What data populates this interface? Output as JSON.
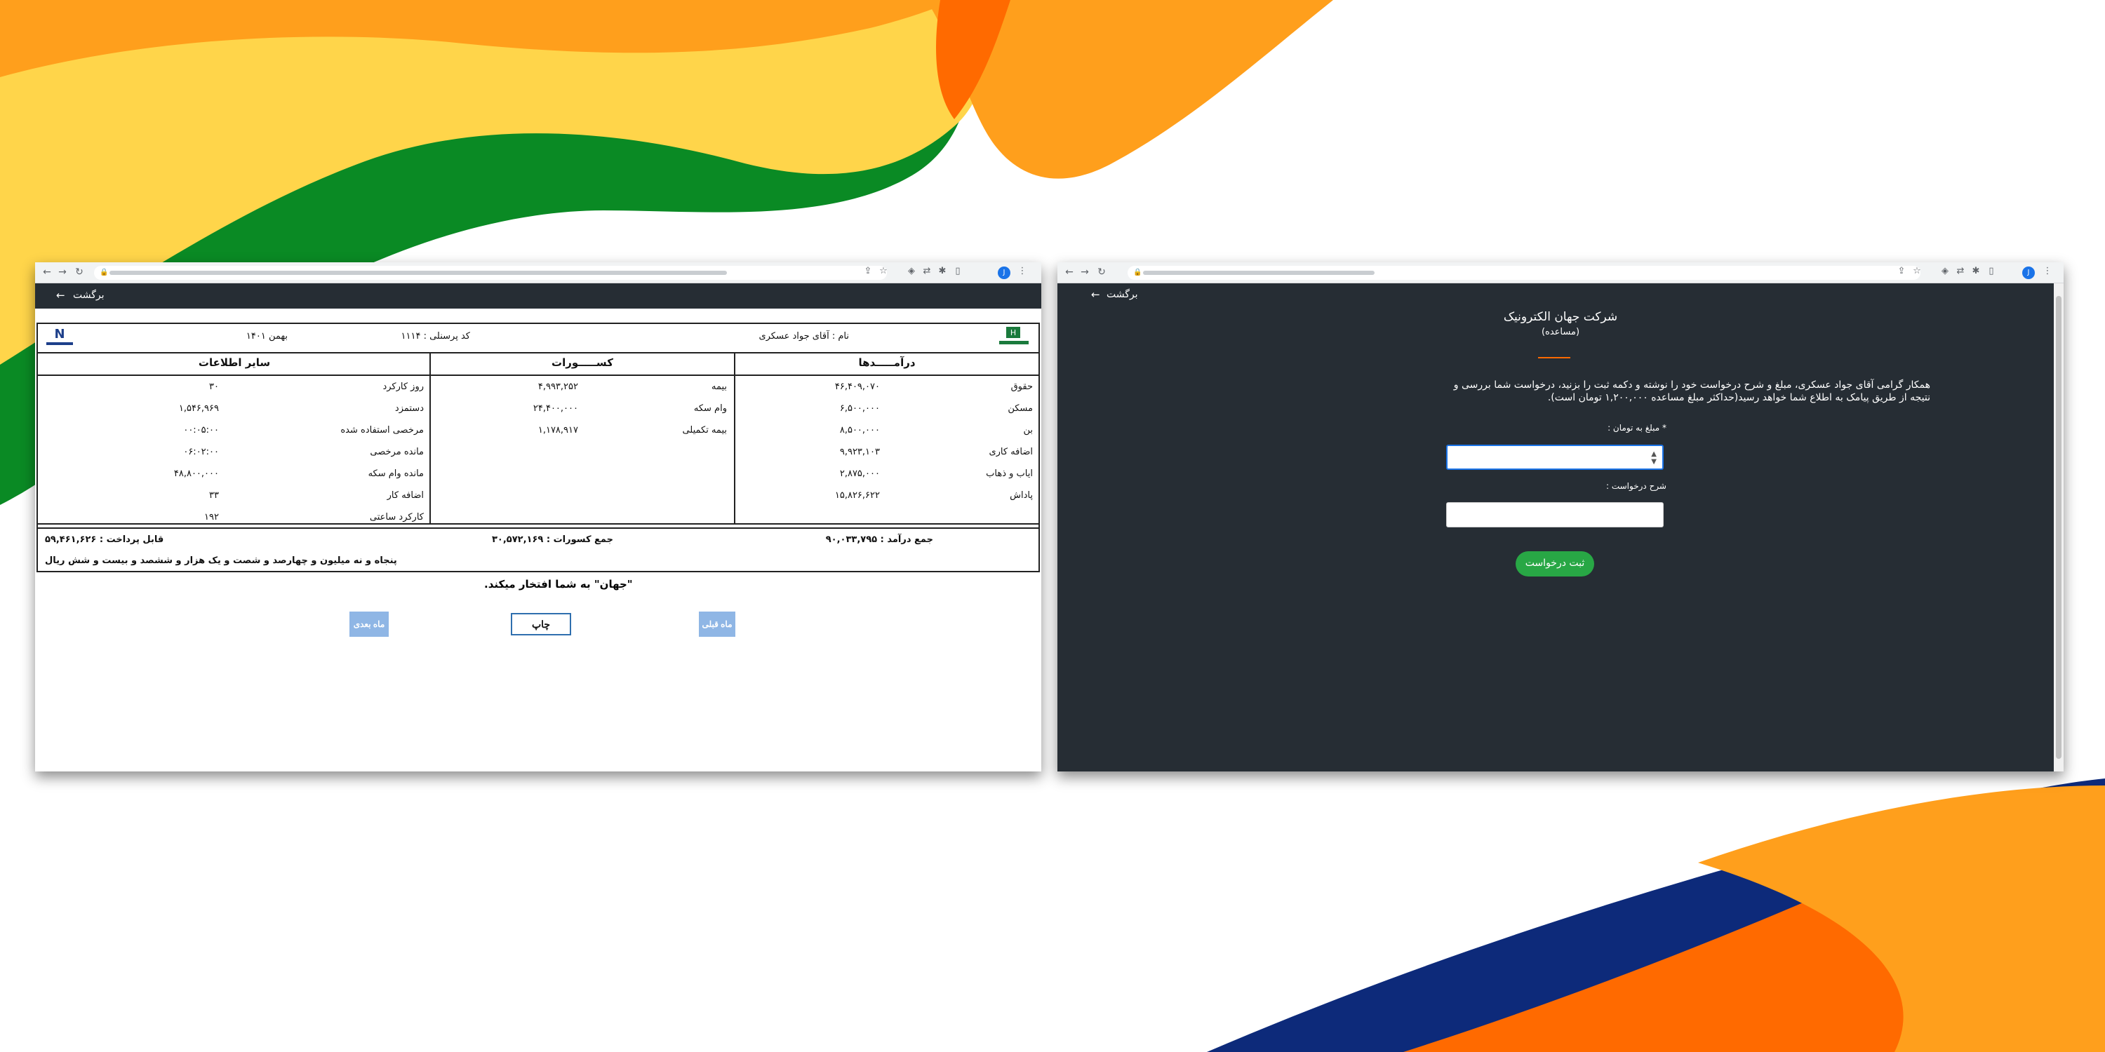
{
  "colors": {
    "dark_bar": "#262d34",
    "accent_orange": "#ff6a00",
    "accent_yellow": "#ffd54a",
    "accent_green": "#0a8a24",
    "submit_green": "#28a745",
    "blue_button": "#8fb6e5"
  },
  "left_window": {
    "back_label": "برگشت",
    "header": {
      "name": "نام : آقای جواد عسکری",
      "code": "کد پرسنلی : ۱۱۱۴",
      "period": "بهمن ۱۴۰۱"
    },
    "columns": {
      "income_title": "درآمـــــدها",
      "deductions_title": "کســـــورات",
      "other_title": "سایر اطلاعات"
    },
    "income": [
      {
        "label": "حقوق",
        "value": "۴۶,۴۰۹,۰۷۰"
      },
      {
        "label": "مسکن",
        "value": "۶,۵۰۰,۰۰۰"
      },
      {
        "label": "بن",
        "value": "۸,۵۰۰,۰۰۰"
      },
      {
        "label": "اضافه کاری",
        "value": "۹,۹۲۳,۱۰۳"
      },
      {
        "label": "ایاب و ذهاب",
        "value": "۲,۸۷۵,۰۰۰"
      },
      {
        "label": "پاداش",
        "value": "۱۵,۸۲۶,۶۲۲"
      }
    ],
    "deductions": [
      {
        "label": "بیمه",
        "value": "۴,۹۹۳,۲۵۲"
      },
      {
        "label": "وام سکه",
        "value": "۲۴,۴۰۰,۰۰۰"
      },
      {
        "label": "بیمه تکمیلی",
        "value": "۱,۱۷۸,۹۱۷"
      }
    ],
    "other": [
      {
        "label": "روز کارکرد",
        "value": "۳۰"
      },
      {
        "label": "دستمزد",
        "value": "۱,۵۴۶,۹۶۹"
      },
      {
        "label": "مرخصی استفاده شده",
        "value": "۰۰:۰۵:۰۰"
      },
      {
        "label": "مانده مرخصی",
        "value": "۰۶:۰۲:۰۰"
      },
      {
        "label": "مانده وام سکه",
        "value": "۴۸,۸۰۰,۰۰۰"
      },
      {
        "label": "اضافه کار",
        "value": "۳۳"
      },
      {
        "label": "کارکرد ساعتی",
        "value": "۱۹۲"
      }
    ],
    "totals": {
      "income_total": "جمع درآمد : ۹۰,۰۳۳,۷۹۵",
      "deductions_total": "جمع کسورات : ۳۰,۵۷۲,۱۶۹",
      "payable": "قابل پرداخت : ۵۹,۴۶۱,۶۲۶"
    },
    "amount_words": "پنجاه و نه میلیون و چهارصد و شصت و یک هزار و ششصد و بیست و شش ریال",
    "pride_line": "\"جهان\" به شما افتخار میکند.",
    "buttons": {
      "prev": "ماه قبلی",
      "print": "چاپ",
      "next": "ماه بعدی"
    }
  },
  "right_window": {
    "back_label": "برگشت",
    "company": "شرکت جهان الکترونیک",
    "subtitle": "(مساعده)",
    "intro_line1": "همکار گرامی آقای جواد عسکری، مبلغ و شرح درخواست خود را نوشته و دکمه ثبت را بزنید، درخواست شما بررسی و",
    "intro_line2": "نتیجه از طریق پیامک به اطلاع شما خواهد رسید(حداکثر مبلغ مساعده ۱,۲۰۰,۰۰۰ تومان است).",
    "amount_label": "* مبلغ به تومان :",
    "amount_value": "",
    "description_label": "شرح درخواست :",
    "description_value": "",
    "submit_label": "ثبت درخواست"
  },
  "browser": {
    "profile_initial": "J"
  }
}
